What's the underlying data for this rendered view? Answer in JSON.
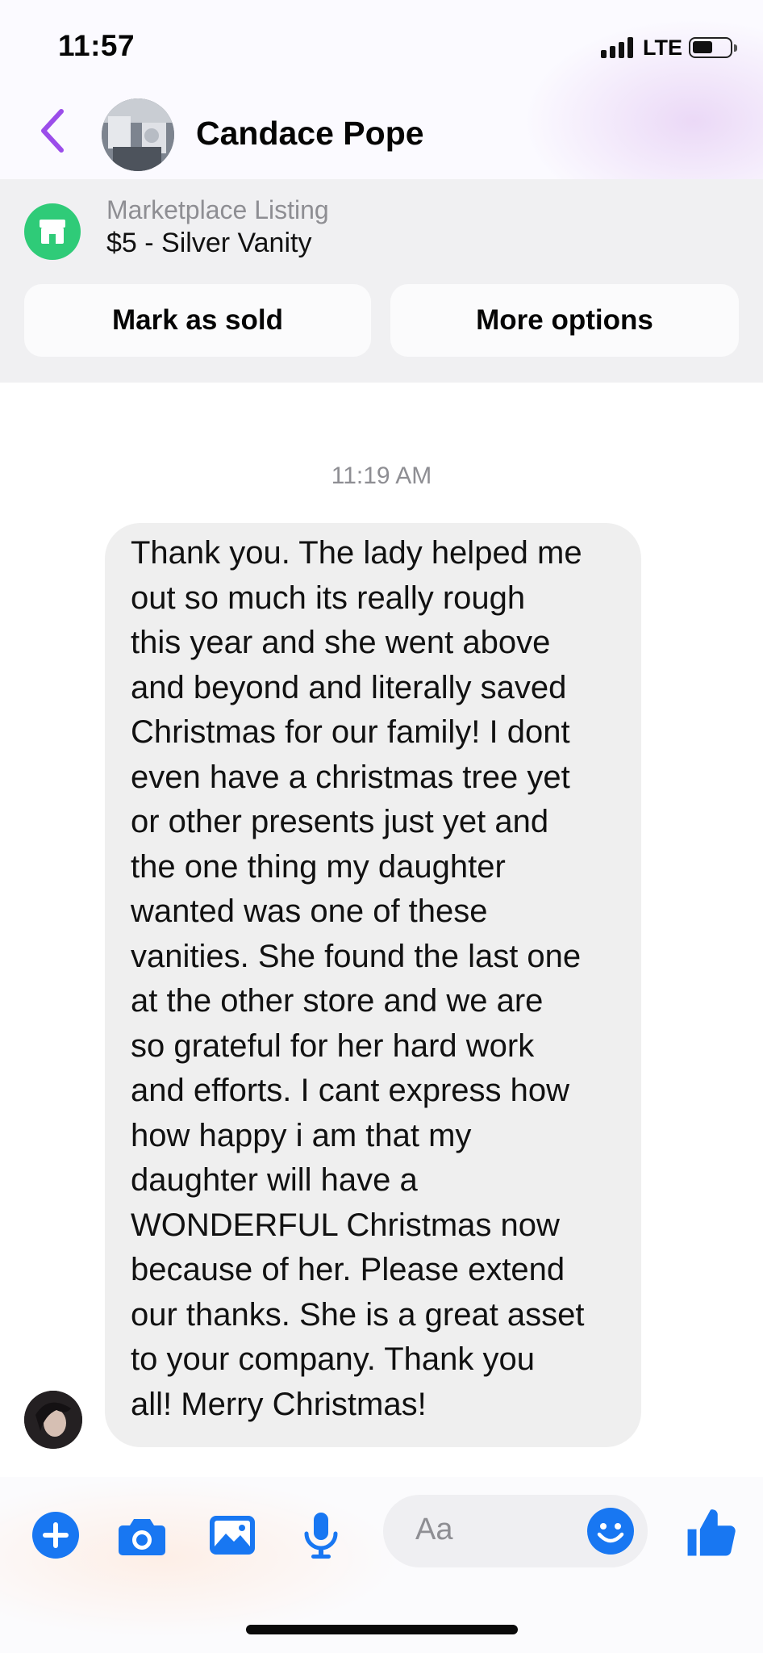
{
  "status_bar": {
    "time": "11:57",
    "network": "LTE"
  },
  "header": {
    "contact_name": "Candace Pope"
  },
  "marketplace": {
    "label": "Marketplace Listing",
    "listing": "$5 - Silver Vanity",
    "mark_sold_label": "Mark as sold",
    "more_options_label": "More options"
  },
  "conversation": {
    "timestamp": "11:19 AM",
    "message_lines": [
      "Thank you. The lady helped me",
      "out so much its really rough",
      "this year and she went above",
      "and beyond and literally saved",
      "Christmas for our family! I dont",
      "even have a christmas tree yet",
      "or other presents just yet and",
      "the one thing my daughter",
      "wanted was one of these",
      "vanities. She found the last one",
      "at the other store and we are",
      "so grateful for her hard work",
      "and efforts. I cant express how",
      "how happy i am that my",
      "daughter will have a",
      "WONDERFUL Christmas now",
      "because of her. Please extend",
      "our thanks. She is a great asset",
      "to your company. Thank you",
      "all! Merry Christmas!"
    ]
  },
  "composer": {
    "placeholder": "Aa"
  },
  "colors": {
    "accent_blue": "#1877f2",
    "back_purple": "#9b4dea",
    "marketplace_green": "#2fcb78",
    "bubble_gray": "#efefef"
  }
}
